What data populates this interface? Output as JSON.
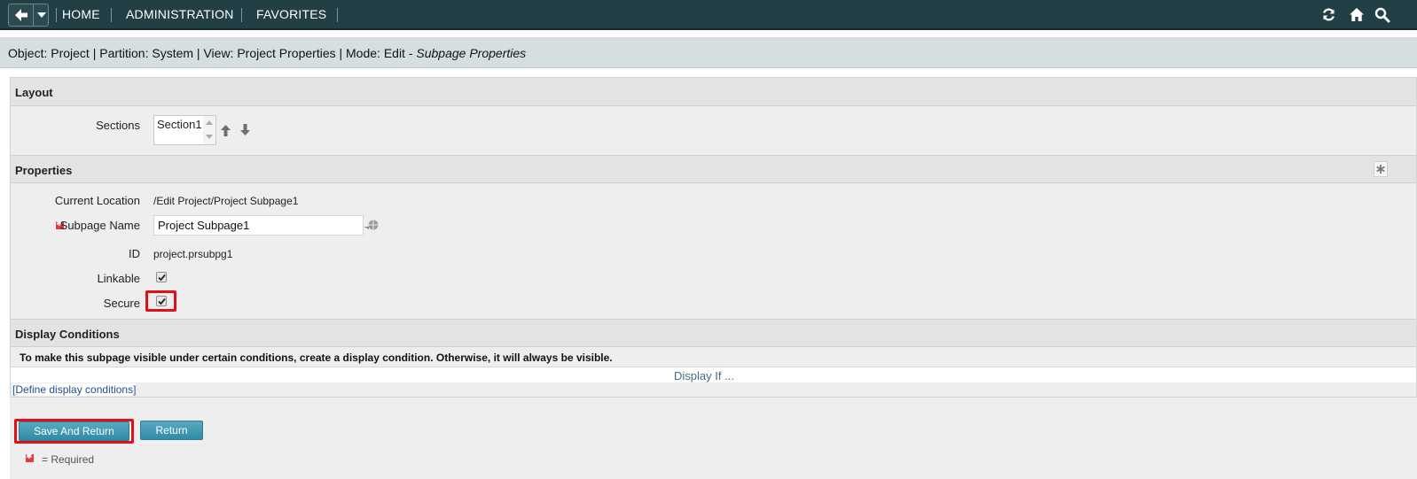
{
  "nav": {
    "items": [
      "HOME",
      "ADMINISTRATION",
      "FAVORITES"
    ]
  },
  "header": {
    "prefix": "Object: Project | Partition: System | View: Project Properties | Mode: Edit - ",
    "mode_detail": "Subpage Properties"
  },
  "layout": {
    "title": "Layout",
    "sections_label": "Sections",
    "sections_options": [
      "Section1"
    ]
  },
  "properties": {
    "title": "Properties",
    "current_location_label": "Current Location",
    "current_location_value": "/Edit Project/Project Subpage1",
    "subpage_name_label": "Subpage Name",
    "subpage_name_value": "Project Subpage1",
    "id_label": "ID",
    "id_value": "project.prsubpg1",
    "linkable_label": "Linkable",
    "linkable_checked": true,
    "secure_label": "Secure",
    "secure_checked": true
  },
  "display_conditions": {
    "title": "Display Conditions",
    "info": "To make this subpage visible under certain conditions, create a display condition. Otherwise, it will always be visible.",
    "display_if": "Display If ...",
    "define_link": "[Define display conditions]"
  },
  "actions": {
    "save_return": "Save And Return",
    "return": "Return"
  },
  "required_note": "= Required",
  "colors": {
    "nav_bg": "#223f45",
    "header_bg": "#d5dfe1",
    "button": "#2f8ba6",
    "highlight": "#e01018",
    "required": "#e53a3a"
  }
}
